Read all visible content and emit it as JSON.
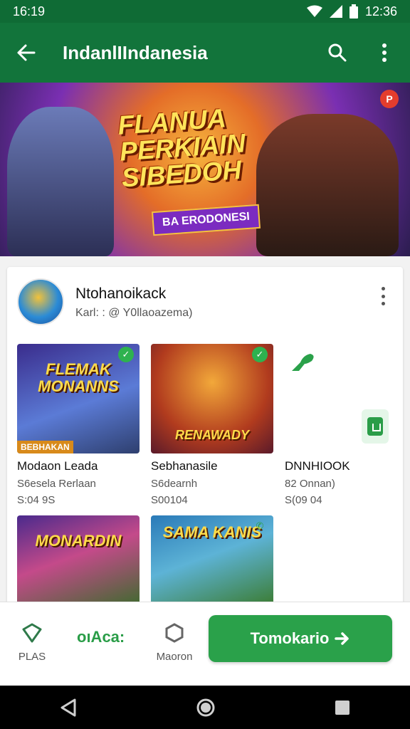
{
  "status_bar": {
    "time": "16:19",
    "right_time": "12:36"
  },
  "app_bar": {
    "title": "IndanlIIndanesia"
  },
  "banner": {
    "title": "FLANUA PERKIAIN SIBEDOH",
    "subtitle": "BA ERODONESI",
    "badge": "P"
  },
  "profile": {
    "name": "Ntohanoikack",
    "subtitle": "Karl: : @ Y0llaoazema)"
  },
  "games": [
    {
      "thumb_text": "FLEMAK MONANNS",
      "corner_text": "BEBHAKAN",
      "title": "Modaon Leada",
      "line1": "S6esela Rerlaan",
      "line2": "S:04 9S"
    },
    {
      "thumb_text": "RENAWADY",
      "title": "Sebhanasile",
      "line1": "S6dearnh",
      "line2": "S00104"
    },
    {
      "title": "DNNHIOOK",
      "line1": "82 Onnan)",
      "line2": "S(09 04"
    },
    {
      "thumb_text": "MONARDIN"
    },
    {
      "thumb_text": "SAMA KANIS"
    }
  ],
  "bottom_nav": {
    "left_label": "PLAS",
    "middle_text": "oıAca:",
    "right_label": "Maoron",
    "cta_label": "Tomokario"
  },
  "colors": {
    "primary": "#12743b",
    "accent": "#2aa14a",
    "banner_purple": "#7b2bc0"
  }
}
